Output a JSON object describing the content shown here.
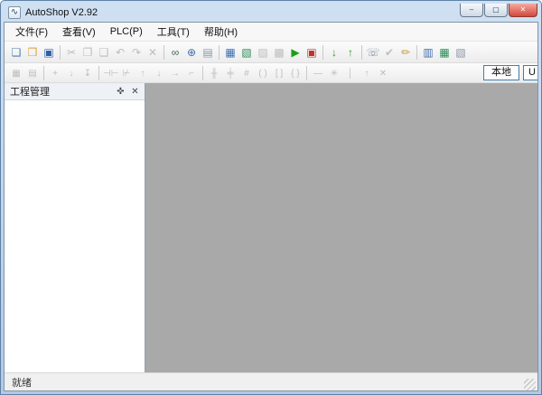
{
  "window": {
    "title": "AutoShop V2.92",
    "icon_glyph": "∿",
    "controls": {
      "minimize": "–",
      "maximize": "▢",
      "close": "✕"
    }
  },
  "menubar": {
    "items": [
      {
        "name": "menu-file",
        "label": "文件(F)"
      },
      {
        "name": "menu-view",
        "label": "查看(V)"
      },
      {
        "name": "menu-plc",
        "label": "PLC(P)"
      },
      {
        "name": "menu-tools",
        "label": "工具(T)"
      },
      {
        "name": "menu-help",
        "label": "帮助(H)"
      }
    ]
  },
  "toolbar_main": {
    "items": [
      {
        "name": "new-file-icon",
        "glyph": "❏",
        "color": "#4f7cb4",
        "enabled": true
      },
      {
        "name": "open-folder-icon",
        "glyph": "❒",
        "color": "#d9a33b",
        "enabled": true
      },
      {
        "name": "save-icon",
        "glyph": "▣",
        "color": "#2f5fa8",
        "enabled": true
      },
      {
        "sep": true
      },
      {
        "name": "cut-icon",
        "glyph": "✂",
        "color": "#b4b4b4",
        "enabled": false
      },
      {
        "name": "copy-icon",
        "glyph": "❐",
        "color": "#b4b4b4",
        "enabled": false
      },
      {
        "name": "paste-icon",
        "glyph": "❑",
        "color": "#b4b4b4",
        "enabled": false
      },
      {
        "name": "undo-icon",
        "glyph": "↶",
        "color": "#b4b4b4",
        "enabled": false
      },
      {
        "name": "redo-icon",
        "glyph": "↷",
        "color": "#b4b4b4",
        "enabled": false
      },
      {
        "name": "delete-icon",
        "glyph": "✕",
        "color": "#b4b4b4",
        "enabled": false
      },
      {
        "sep": true
      },
      {
        "name": "find-icon",
        "glyph": "∞",
        "color": "#44655f",
        "enabled": true
      },
      {
        "name": "zoom-icon",
        "glyph": "⊕",
        "color": "#3f6fae",
        "enabled": true
      },
      {
        "name": "print-icon",
        "glyph": "▤",
        "color": "#8a96a8",
        "enabled": true
      },
      {
        "sep": true
      },
      {
        "name": "window-cascade-icon",
        "glyph": "▦",
        "color": "#3f6fae",
        "enabled": true
      },
      {
        "name": "instruction-tree-icon",
        "glyph": "▧",
        "color": "#2e8b57",
        "enabled": true
      },
      {
        "name": "output-window-icon",
        "glyph": "▨",
        "color": "#b4b4b4",
        "enabled": false
      },
      {
        "name": "watch-window-icon",
        "glyph": "▩",
        "color": "#b4b4b4",
        "enabled": false
      },
      {
        "name": "run-icon",
        "glyph": "▶",
        "color": "#18a018",
        "enabled": true
      },
      {
        "name": "stop-monitor-icon",
        "glyph": "▣",
        "color": "#c03030",
        "enabled": true
      },
      {
        "sep": true
      },
      {
        "name": "download-icon",
        "glyph": "↓",
        "color": "#18a018",
        "enabled": true
      },
      {
        "name": "upload-icon",
        "glyph": "↑",
        "color": "#18a018",
        "enabled": true
      },
      {
        "sep": true
      },
      {
        "name": "comm-settings-icon",
        "glyph": "☏",
        "color": "#8a96a8",
        "enabled": true
      },
      {
        "name": "compile-check-icon",
        "glyph": "✔",
        "color": "#b4b4b4",
        "enabled": false
      },
      {
        "name": "edit-pencil-icon",
        "glyph": "✏",
        "color": "#c59a30",
        "enabled": true
      },
      {
        "sep": true
      },
      {
        "name": "device-monitor-icon",
        "glyph": "▥",
        "color": "#3f6fae",
        "enabled": true
      },
      {
        "name": "io-table-icon",
        "glyph": "▦",
        "color": "#2e8b57",
        "enabled": true
      },
      {
        "name": "options-icon",
        "glyph": "▧",
        "color": "#8a96a8",
        "enabled": true
      }
    ]
  },
  "toolbar_ladder": {
    "local_label": "本地",
    "usb_label": "U",
    "items": [
      {
        "name": "ladder-view-icon",
        "glyph": "▦",
        "color": "#b4b4b4",
        "enabled": false
      },
      {
        "name": "il-view-icon",
        "glyph": "▤",
        "color": "#b4b4b4",
        "enabled": false
      },
      {
        "sep": true
      },
      {
        "name": "insert-row-icon",
        "glyph": "+",
        "color": "#b4b4b4",
        "enabled": false
      },
      {
        "name": "append-row-icon",
        "glyph": "↓",
        "color": "#b4b4b4",
        "enabled": false
      },
      {
        "name": "move-down-icon",
        "glyph": "↧",
        "color": "#b4b4b4",
        "enabled": false
      },
      {
        "sep": true
      },
      {
        "name": "open-contact-icon",
        "glyph": "⊣⊢",
        "color": "#b4b4b4",
        "enabled": false
      },
      {
        "name": "closed-contact-icon",
        "glyph": "⊬",
        "color": "#b4b4b4",
        "enabled": false
      },
      {
        "name": "rising-edge-icon",
        "glyph": "↑",
        "color": "#b4b4b4",
        "enabled": false
      },
      {
        "name": "falling-edge-icon",
        "glyph": "↓",
        "color": "#b4b4b4",
        "enabled": false
      },
      {
        "name": "horizontal-line-icon",
        "glyph": "→",
        "color": "#b4b4b4",
        "enabled": false
      },
      {
        "name": "corner-line-icon",
        "glyph": "⌐",
        "color": "#b4b4b4",
        "enabled": false
      },
      {
        "sep": true
      },
      {
        "name": "parallel-open-icon",
        "glyph": "╫",
        "color": "#b4b4b4",
        "enabled": false
      },
      {
        "name": "parallel-closed-icon",
        "glyph": "╪",
        "color": "#b4b4b4",
        "enabled": false
      },
      {
        "name": "network-grid-icon",
        "glyph": "#",
        "color": "#b4b4b4",
        "enabled": false
      },
      {
        "name": "coil-icon",
        "glyph": "( )",
        "color": "#b4b4b4",
        "enabled": false
      },
      {
        "name": "apply-block-icon",
        "glyph": "[ ]",
        "color": "#b4b4b4",
        "enabled": false
      },
      {
        "name": "func-block-icon",
        "glyph": "{ }",
        "color": "#b4b4b4",
        "enabled": false
      },
      {
        "sep": true
      },
      {
        "name": "hline-tool-icon",
        "glyph": "—",
        "color": "#b4b4b4",
        "enabled": false
      },
      {
        "name": "convert-icon",
        "glyph": "✳",
        "color": "#b4b4b4",
        "enabled": false
      },
      {
        "name": "vline-tool-icon",
        "glyph": "│",
        "color": "#b4b4b4",
        "enabled": false
      },
      {
        "name": "up-branch-icon",
        "glyph": "↑",
        "color": "#b4b4b4",
        "enabled": false
      },
      {
        "name": "delete-branch-icon",
        "glyph": "✕",
        "color": "#b4b4b4",
        "enabled": false
      }
    ]
  },
  "project_panel": {
    "title": "工程管理",
    "pin_glyph": "✜",
    "close_glyph": "✕"
  },
  "statusbar": {
    "ready": "就绪"
  }
}
